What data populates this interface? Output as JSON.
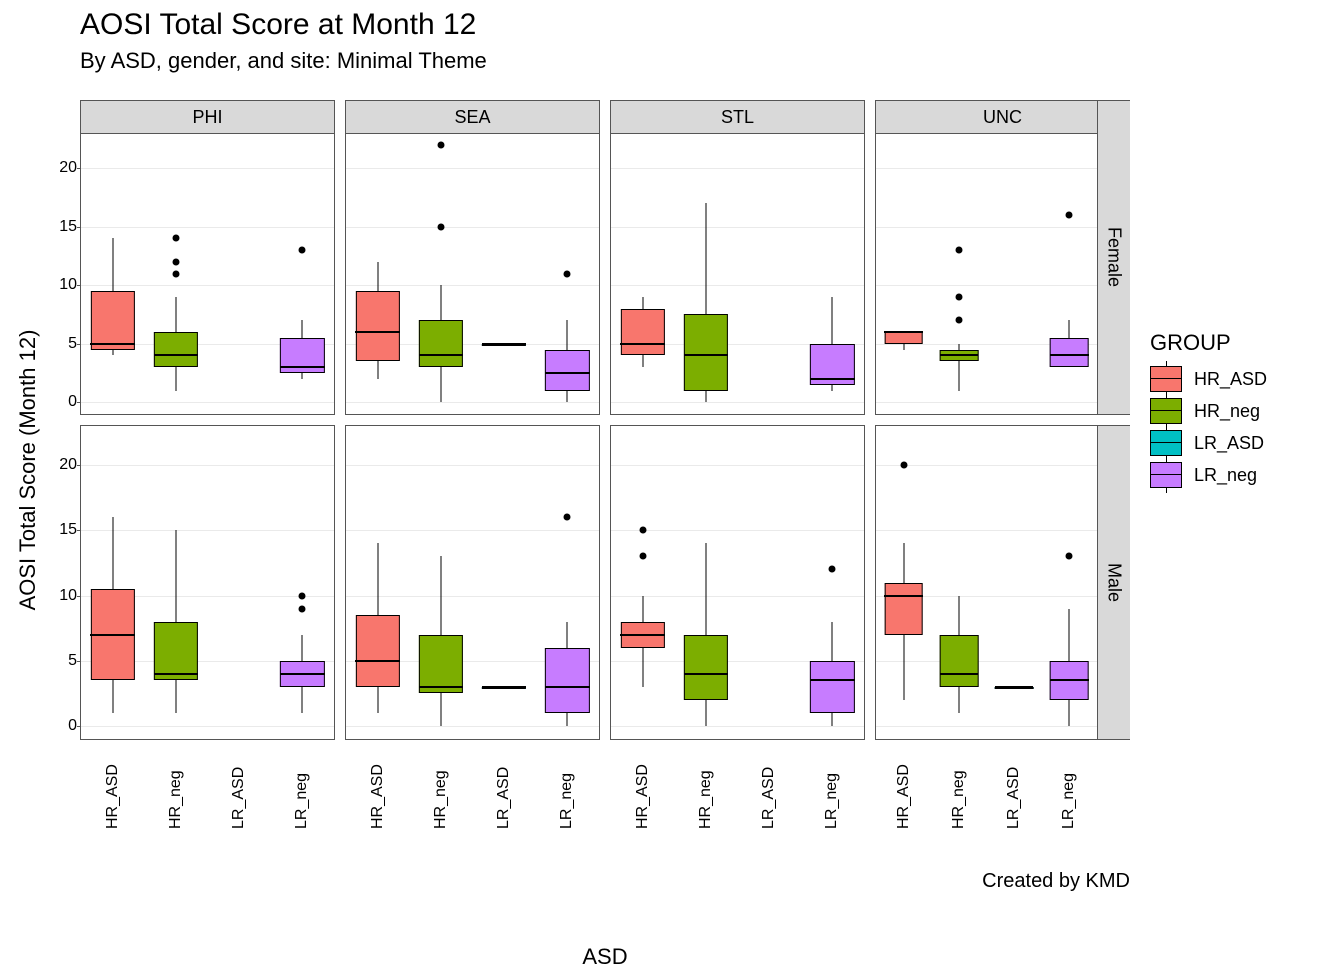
{
  "chart_data": {
    "type": "boxplot",
    "title": "AOSI Total Score at Month 12",
    "subtitle": "By ASD, gender, and site: Minimal Theme",
    "caption": "Created by KMD",
    "xlabel": "ASD",
    "ylabel": "AOSI Total Score (Month 12)",
    "ylim": [
      -1,
      23
    ],
    "yticks": [
      0,
      5,
      10,
      15,
      20
    ],
    "x_categories": [
      "HR_ASD",
      "HR_neg",
      "LR_ASD",
      "LR_neg"
    ],
    "facet_cols": [
      "PHI",
      "SEA",
      "STL",
      "UNC"
    ],
    "facet_rows": [
      "Female",
      "Male"
    ],
    "groups": {
      "HR_ASD": "#F8766D",
      "HR_neg": "#7CAE00",
      "LR_ASD": "#00BFC4",
      "LR_neg": "#C77CFF"
    },
    "panels": {
      "PHI|Female": {
        "HR_ASD": {
          "min": 4,
          "q1": 4.5,
          "median": 5,
          "q3": 9.5,
          "max": 14,
          "outliers": []
        },
        "HR_neg": {
          "min": 1,
          "q1": 3,
          "median": 4,
          "q3": 6,
          "max": 9,
          "outliers": [
            11,
            12,
            14
          ]
        },
        "LR_ASD": null,
        "LR_neg": {
          "min": 2,
          "q1": 2.5,
          "median": 3,
          "q3": 5.5,
          "max": 7,
          "outliers": [
            13
          ]
        }
      },
      "SEA|Female": {
        "HR_ASD": {
          "min": 2,
          "q1": 3.5,
          "median": 6,
          "q3": 9.5,
          "max": 12,
          "outliers": []
        },
        "HR_neg": {
          "min": 0,
          "q1": 3,
          "median": 4,
          "q3": 7,
          "max": 10,
          "outliers": [
            15,
            22
          ]
        },
        "LR_ASD": {
          "min": 5,
          "q1": 5,
          "median": 5,
          "q3": 5,
          "max": 5,
          "outliers": []
        },
        "LR_neg": {
          "min": 0,
          "q1": 1,
          "median": 2.5,
          "q3": 4.5,
          "max": 7,
          "outliers": [
            11
          ]
        }
      },
      "STL|Female": {
        "HR_ASD": {
          "min": 3,
          "q1": 4,
          "median": 5,
          "q3": 8,
          "max": 9,
          "outliers": []
        },
        "HR_neg": {
          "min": 0,
          "q1": 1,
          "median": 4,
          "q3": 7.5,
          "max": 17,
          "outliers": []
        },
        "LR_ASD": null,
        "LR_neg": {
          "min": 1,
          "q1": 1.5,
          "median": 2,
          "q3": 5,
          "max": 9,
          "outliers": []
        }
      },
      "UNC|Female": {
        "HR_ASD": {
          "min": 4.5,
          "q1": 5,
          "median": 6,
          "q3": 6,
          "max": 6,
          "outliers": []
        },
        "HR_neg": {
          "min": 1,
          "q1": 3.5,
          "median": 4,
          "q3": 4.5,
          "max": 5,
          "outliers": [
            7,
            9,
            13
          ]
        },
        "LR_ASD": null,
        "LR_neg": {
          "min": 3,
          "q1": 3,
          "median": 4,
          "q3": 5.5,
          "max": 7,
          "outliers": [
            16
          ]
        }
      },
      "PHI|Male": {
        "HR_ASD": {
          "min": 1,
          "q1": 3.5,
          "median": 7,
          "q3": 10.5,
          "max": 16,
          "outliers": []
        },
        "HR_neg": {
          "min": 1,
          "q1": 3.5,
          "median": 4,
          "q3": 8,
          "max": 15,
          "outliers": []
        },
        "LR_ASD": null,
        "LR_neg": {
          "min": 1,
          "q1": 3,
          "median": 4,
          "q3": 5,
          "max": 7,
          "outliers": [
            9,
            10
          ]
        }
      },
      "SEA|Male": {
        "HR_ASD": {
          "min": 1,
          "q1": 3,
          "median": 5,
          "q3": 8.5,
          "max": 14,
          "outliers": []
        },
        "HR_neg": {
          "min": 0,
          "q1": 2.5,
          "median": 3,
          "q3": 7,
          "max": 13,
          "outliers": []
        },
        "LR_ASD": {
          "min": 3,
          "q1": 3,
          "median": 3,
          "q3": 3,
          "max": 3,
          "outliers": []
        },
        "LR_neg": {
          "min": 0,
          "q1": 1,
          "median": 3,
          "q3": 6,
          "max": 8,
          "outliers": [
            16
          ]
        }
      },
      "STL|Male": {
        "HR_ASD": {
          "min": 3,
          "q1": 6,
          "median": 7,
          "q3": 8,
          "max": 10,
          "outliers": [
            13,
            15
          ]
        },
        "HR_neg": {
          "min": 0,
          "q1": 2,
          "median": 4,
          "q3": 7,
          "max": 14,
          "outliers": []
        },
        "LR_ASD": null,
        "LR_neg": {
          "min": 0,
          "q1": 1,
          "median": 3.5,
          "q3": 5,
          "max": 8,
          "outliers": [
            12
          ]
        }
      },
      "UNC|Male": {
        "HR_ASD": {
          "min": 2,
          "q1": 7,
          "median": 10,
          "q3": 11,
          "max": 14,
          "outliers": [
            20
          ]
        },
        "HR_neg": {
          "min": 1,
          "q1": 3,
          "median": 4,
          "q3": 7,
          "max": 10,
          "outliers": []
        },
        "LR_ASD": {
          "min": 3,
          "q1": 3,
          "median": 3,
          "q3": 3,
          "max": 3,
          "outliers": []
        },
        "LR_neg": {
          "min": 0,
          "q1": 2,
          "median": 3.5,
          "q3": 5,
          "max": 9,
          "outliers": [
            13
          ]
        }
      }
    },
    "legend": {
      "title": "GROUP",
      "items": [
        "HR_ASD",
        "HR_neg",
        "LR_ASD",
        "LR_neg"
      ]
    }
  }
}
